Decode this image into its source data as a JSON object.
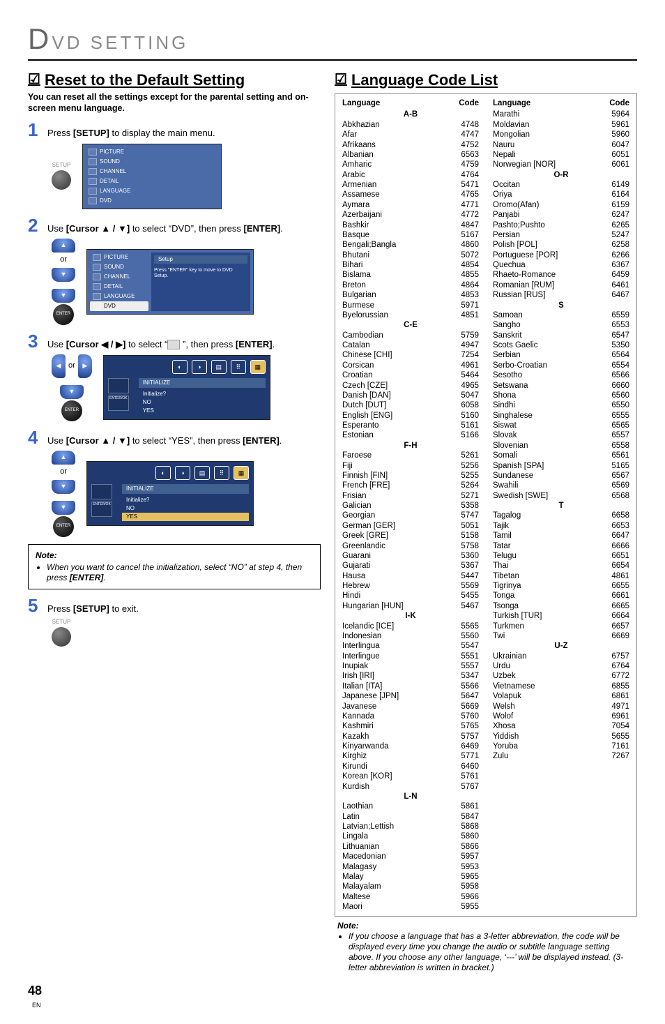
{
  "pageHeader": {
    "bigLetter": "D",
    "rest": "VD SETTING"
  },
  "left": {
    "title": "Reset to the Default Setting",
    "subtitle": "You can reset all the settings except for the parental setting and on-screen menu language.",
    "steps": {
      "1": {
        "num": "1",
        "text_a": "Press ",
        "text_b": "[SETUP]",
        "text_c": " to display the main menu.",
        "setupLabel": "SETUP"
      },
      "2": {
        "num": "2",
        "text_a": "Use ",
        "text_b": "[Cursor ▲ / ▼]",
        "text_c": " to select “DVD”, then press ",
        "text_d": "[ENTER]",
        "text_e": ".",
        "or": "or",
        "enter": "ENTER"
      },
      "3": {
        "num": "3",
        "text_a": "Use ",
        "text_b": "[Cursor ◀ / ▶]",
        "text_c": " to select “",
        "iconHint": "(DVD init icon)",
        "text_d": " ”, then press ",
        "text_e": "[ENTER]",
        "text_f": ".",
        "or": "or",
        "enter": "ENTER"
      },
      "4": {
        "num": "4",
        "text_a": "Use ",
        "text_b": "[Cursor ▲ / ▼]",
        "text_c": " to select “YES”, then press ",
        "text_d": "[ENTER]",
        "text_e": ".",
        "or": "or",
        "enter": "ENTER"
      },
      "5": {
        "num": "5",
        "text_a": "Press ",
        "text_b": "[SETUP]",
        "text_c": " to exit.",
        "setupLabel": "SETUP"
      }
    },
    "osd1Items": [
      "PICTURE",
      "SOUND",
      "CHANNEL",
      "DETAIL",
      "LANGUAGE",
      "DVD"
    ],
    "osd2": {
      "setupLabel": "Setup",
      "hint": "Press \"ENTER\" key to move to DVD Setup.",
      "items": [
        "PICTURE",
        "SOUND",
        "CHANNEL",
        "DETAIL",
        "LANGUAGE",
        "DVD"
      ]
    },
    "osd3": {
      "header": "INITIALIZE",
      "lines": [
        "Initialize?",
        "NO",
        "YES"
      ],
      "enterOk": "ENTER/OK"
    },
    "osd4": {
      "header": "INITIALIZE",
      "lines": [
        "Initialize?",
        "NO",
        "YES"
      ],
      "hl": "YES",
      "enterOk": "ENTER/OK"
    },
    "note": {
      "title": "Note:",
      "text_a": "When you want to cancel the initialization, select “NO” at step 4, then press ",
      "text_b": "[ENTER]",
      "text_c": "."
    }
  },
  "lang": {
    "title": "Language Code List",
    "headers": {
      "lang": "Language",
      "code": "Code"
    },
    "col1": {
      "groups": [
        {
          "label": "A-B",
          "rows": [
            [
              "Abkhazian",
              "4748"
            ],
            [
              "Afar",
              "4747"
            ],
            [
              "Afrikaans",
              "4752"
            ],
            [
              "Albanian",
              "6563"
            ],
            [
              "Amharic",
              "4759"
            ],
            [
              "Arabic",
              "4764"
            ],
            [
              "Armenian",
              "5471"
            ],
            [
              "Assamese",
              "4765"
            ],
            [
              "Aymara",
              "4771"
            ],
            [
              "Azerbaijani",
              "4772"
            ],
            [
              "Bashkir",
              "4847"
            ],
            [
              "Basque",
              "5167"
            ],
            [
              "Bengali;Bangla",
              "4860"
            ],
            [
              "Bhutani",
              "5072"
            ],
            [
              "Bihari",
              "4854"
            ],
            [
              "Bislama",
              "4855"
            ],
            [
              "Breton",
              "4864"
            ],
            [
              "Bulgarian",
              "4853"
            ],
            [
              "Burmese",
              "5971"
            ],
            [
              "Byelorussian",
              "4851"
            ]
          ]
        },
        {
          "label": "C-E",
          "rows": [
            [
              "Cambodian",
              "5759"
            ],
            [
              "Catalan",
              "4947"
            ],
            [
              "Chinese [CHI]",
              "7254"
            ],
            [
              "Corsican",
              "4961"
            ],
            [
              "Croatian",
              "5464"
            ],
            [
              "Czech [CZE]",
              "4965"
            ],
            [
              "Danish [DAN]",
              "5047"
            ],
            [
              "Dutch [DUT]",
              "6058"
            ],
            [
              "English [ENG]",
              "5160"
            ],
            [
              "Esperanto",
              "5161"
            ],
            [
              "Estonian",
              "5166"
            ]
          ]
        },
        {
          "label": "F-H",
          "rows": [
            [
              "Faroese",
              "5261"
            ],
            [
              "Fiji",
              "5256"
            ],
            [
              "Finnish [FIN]",
              "5255"
            ],
            [
              "French [FRE]",
              "5264"
            ],
            [
              "Frisian",
              "5271"
            ],
            [
              "Galician",
              "5358"
            ],
            [
              "Georgian",
              "5747"
            ],
            [
              "German [GER]",
              "5051"
            ],
            [
              "Greek [GRE]",
              "5158"
            ],
            [
              "Greenlandic",
              "5758"
            ],
            [
              "Guarani",
              "5360"
            ],
            [
              "Gujarati",
              "5367"
            ],
            [
              "Hausa",
              "5447"
            ],
            [
              "Hebrew",
              "5569"
            ],
            [
              "Hindi",
              "5455"
            ],
            [
              "Hungarian [HUN]",
              "5467"
            ]
          ]
        },
        {
          "label": "I-K",
          "rows": [
            [
              "Icelandic [ICE]",
              "5565"
            ],
            [
              "Indonesian",
              "5560"
            ],
            [
              "Interlingua",
              "5547"
            ],
            [
              "Interlingue",
              "5551"
            ],
            [
              "Inupiak",
              "5557"
            ],
            [
              "Irish [IRI]",
              "5347"
            ],
            [
              "Italian [ITA]",
              "5566"
            ],
            [
              "Japanese [JPN]",
              "5647"
            ],
            [
              "Javanese",
              "5669"
            ],
            [
              "Kannada",
              "5760"
            ],
            [
              "Kashmiri",
              "5765"
            ],
            [
              "Kazakh",
              "5757"
            ],
            [
              "Kinyarwanda",
              "6469"
            ],
            [
              "Kirghiz",
              "5771"
            ],
            [
              "Kirundi",
              "6460"
            ],
            [
              "Korean [KOR]",
              "5761"
            ],
            [
              "Kurdish",
              "5767"
            ]
          ]
        },
        {
          "label": "L-N",
          "rows": [
            [
              "Laothian",
              "5861"
            ],
            [
              "Latin",
              "5847"
            ],
            [
              "Latvian;Lettish",
              "5868"
            ],
            [
              "Lingala",
              "5860"
            ],
            [
              "Lithuanian",
              "5866"
            ],
            [
              "Macedonian",
              "5957"
            ],
            [
              "Malagasy",
              "5953"
            ],
            [
              "Malay",
              "5965"
            ],
            [
              "Malayalam",
              "5958"
            ],
            [
              "Maltese",
              "5966"
            ],
            [
              "Maori",
              "5955"
            ]
          ]
        }
      ]
    },
    "col2": {
      "groups": [
        {
          "label": "",
          "rows": [
            [
              "Marathi",
              "5964"
            ],
            [
              "Moldavian",
              "5961"
            ],
            [
              "Mongolian",
              "5960"
            ],
            [
              "Nauru",
              "6047"
            ],
            [
              "Nepali",
              "6051"
            ],
            [
              "Norwegian [NOR]",
              "6061"
            ]
          ]
        },
        {
          "label": "O-R",
          "rows": [
            [
              "Occitan",
              "6149"
            ],
            [
              "Oriya",
              "6164"
            ],
            [
              "Oromo(Afan)",
              "6159"
            ],
            [
              "Panjabi",
              "6247"
            ],
            [
              "Pashto;Pushto",
              "6265"
            ],
            [
              "Persian",
              "5247"
            ],
            [
              "Polish [POL]",
              "6258"
            ],
            [
              "Portuguese [POR]",
              "6266"
            ],
            [
              "Quechua",
              "6367"
            ],
            [
              "Rhaeto-Romance",
              "6459"
            ],
            [
              "Romanian [RUM]",
              "6461"
            ],
            [
              "Russian [RUS]",
              "6467"
            ]
          ]
        },
        {
          "label": "S",
          "rows": [
            [
              "Samoan",
              "6559"
            ],
            [
              "Sangho",
              "6553"
            ],
            [
              "Sanskrit",
              "6547"
            ],
            [
              "Scots Gaelic",
              "5350"
            ],
            [
              "Serbian",
              "6564"
            ],
            [
              "Serbo-Croatian",
              "6554"
            ],
            [
              "Sesotho",
              "6566"
            ],
            [
              "Setswana",
              "6660"
            ],
            [
              "Shona",
              "6560"
            ],
            [
              "Sindhi",
              "6550"
            ],
            [
              "Singhalese",
              "6555"
            ],
            [
              "Siswat",
              "6565"
            ],
            [
              "Slovak",
              "6557"
            ],
            [
              "Slovenian",
              "6558"
            ],
            [
              "Somali",
              "6561"
            ],
            [
              "Spanish [SPA]",
              "5165"
            ],
            [
              "Sundanese",
              "6567"
            ],
            [
              "Swahili",
              "6569"
            ],
            [
              "Swedish [SWE]",
              "6568"
            ]
          ]
        },
        {
          "label": "T",
          "rows": [
            [
              "Tagalog",
              "6658"
            ],
            [
              "Tajik",
              "6653"
            ],
            [
              "Tamil",
              "6647"
            ],
            [
              "Tatar",
              "6666"
            ],
            [
              "Telugu",
              "6651"
            ],
            [
              "Thai",
              "6654"
            ],
            [
              "Tibetan",
              "4861"
            ],
            [
              "Tigrinya",
              "6655"
            ],
            [
              "Tonga",
              "6661"
            ],
            [
              "Tsonga",
              "6665"
            ],
            [
              "Turkish [TUR]",
              "6664"
            ],
            [
              "Turkmen",
              "6657"
            ],
            [
              "Twi",
              "6669"
            ]
          ]
        },
        {
          "label": "U-Z",
          "rows": [
            [
              "Ukrainian",
              "6757"
            ],
            [
              "Urdu",
              "6764"
            ],
            [
              "Uzbek",
              "6772"
            ],
            [
              "Vietnamese",
              "6855"
            ],
            [
              "Volapuk",
              "6861"
            ],
            [
              "Welsh",
              "4971"
            ],
            [
              "Wolof",
              "6961"
            ],
            [
              "Xhosa",
              "7054"
            ],
            [
              "Yiddish",
              "5655"
            ],
            [
              "Yoruba",
              "7161"
            ],
            [
              "Zulu",
              "7267"
            ]
          ]
        }
      ]
    },
    "note": {
      "title": "Note:",
      "text": "If you choose a language that has a 3-letter abbreviation, the code will be displayed every time you change the audio or subtitle language setting above. If you choose any other language, ‘---’ will be displayed instead. (3-letter abbreviation is written in bracket.)"
    }
  },
  "pageNum": {
    "n": "48",
    "en": "EN"
  }
}
